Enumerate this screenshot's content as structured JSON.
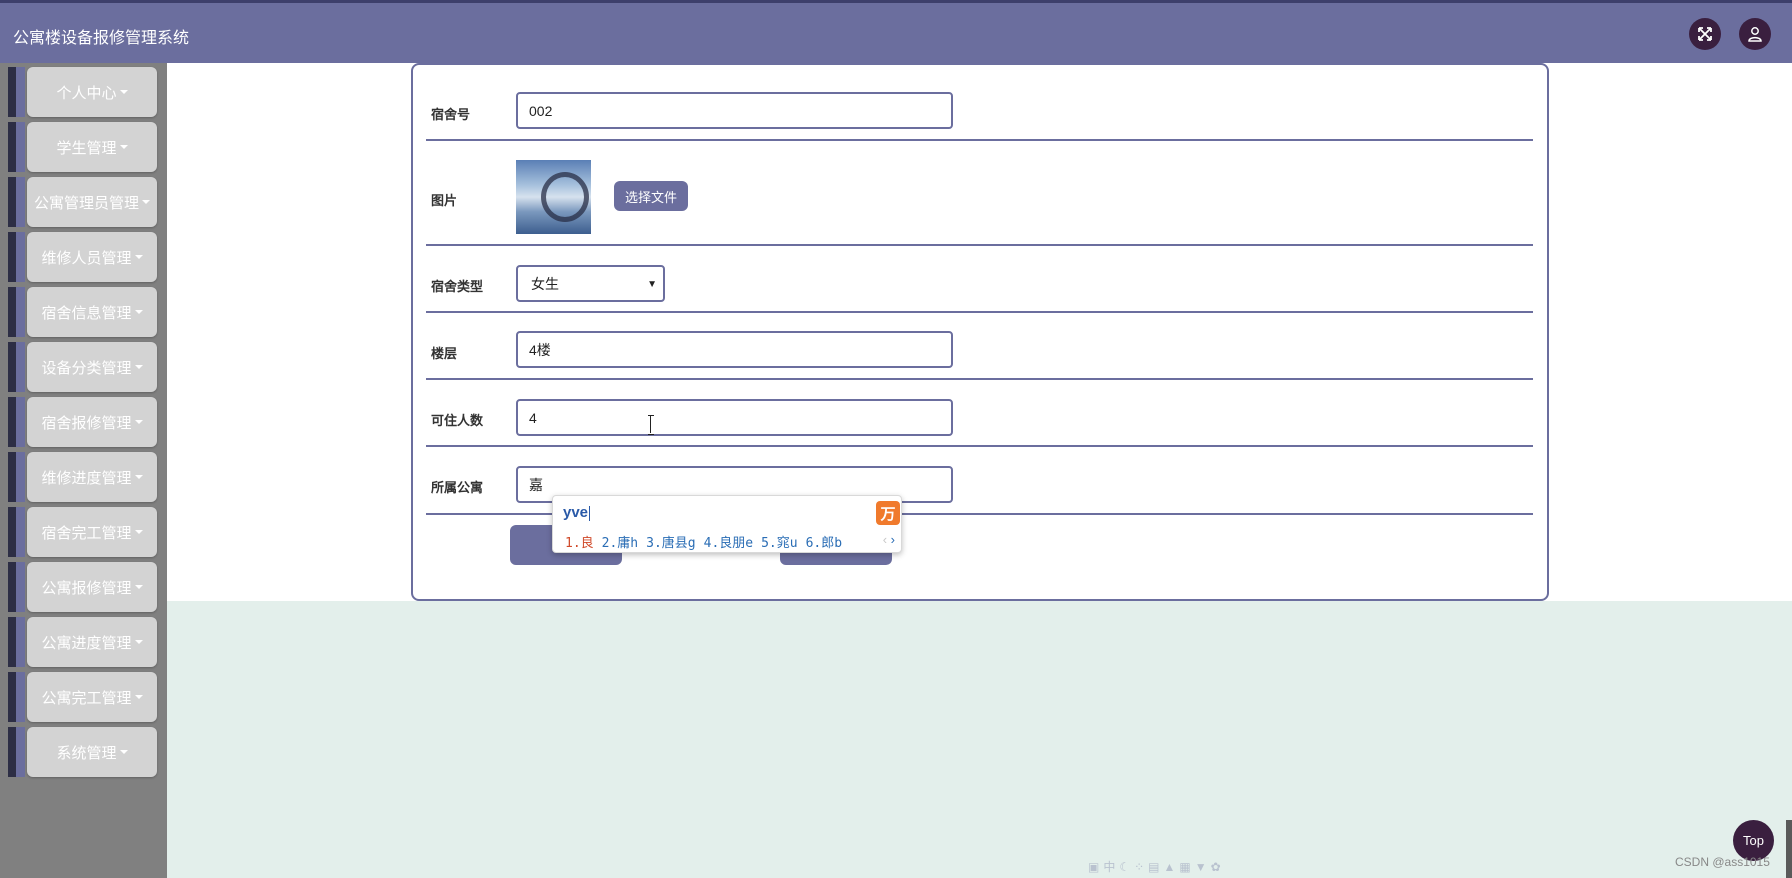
{
  "app": {
    "title": "公寓楼设备报修管理系统"
  },
  "header": {
    "fullscreen_icon": "expand-arrows-icon",
    "user_icon": "user-icon"
  },
  "sidebar": {
    "items": [
      {
        "label": "个人中心"
      },
      {
        "label": "学生管理"
      },
      {
        "label": "公寓管理员管理"
      },
      {
        "label": "维修人员管理"
      },
      {
        "label": "宿舍信息管理"
      },
      {
        "label": "设备分类管理"
      },
      {
        "label": "宿舍报修管理"
      },
      {
        "label": "维修进度管理"
      },
      {
        "label": "宿舍完工管理"
      },
      {
        "label": "公寓报修管理"
      },
      {
        "label": "公寓进度管理"
      },
      {
        "label": "公寓完工管理"
      },
      {
        "label": "系统管理"
      }
    ]
  },
  "form": {
    "dorm_no": {
      "label": "宿舍号",
      "value": "002"
    },
    "image": {
      "label": "图片",
      "button": "选择文件"
    },
    "dorm_type": {
      "label": "宿舍类型",
      "value": "女生"
    },
    "floor": {
      "label": "楼层",
      "value": "4楼"
    },
    "capacity": {
      "label": "可住人数",
      "value": "4"
    },
    "apartment": {
      "label": "所属公寓",
      "value": "嘉"
    }
  },
  "ime": {
    "composition": "yve",
    "candidates": [
      "1.良",
      "2.庸h",
      "3.唐县g",
      "4.良朋e",
      "5.窕u",
      "6.郎b"
    ],
    "logo": "万"
  },
  "floating": {
    "top_button": "Top"
  },
  "watermark": "CSDN @ass1015",
  "colors": {
    "primary": "#6b6e9e",
    "sidebar": "#808080",
    "background": "#e3efeb",
    "dark_button": "#3a1f3f"
  }
}
